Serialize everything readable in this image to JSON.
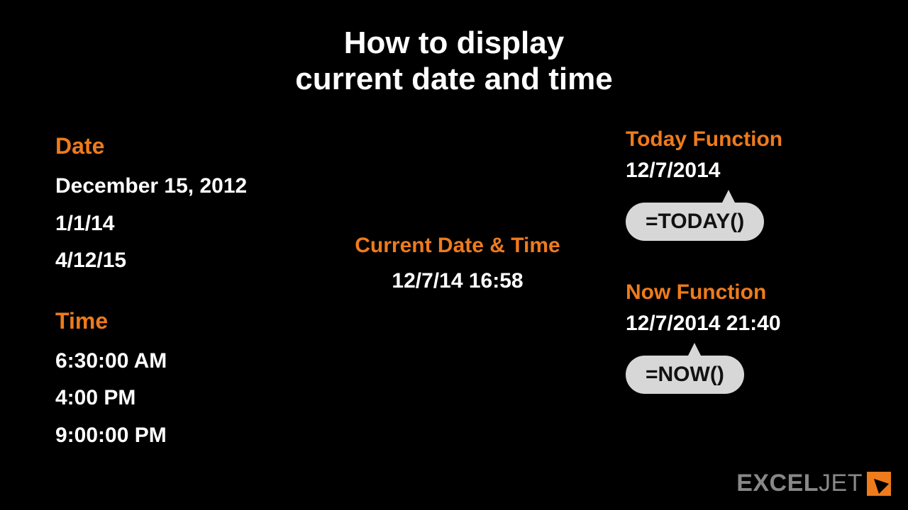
{
  "title_line1": "How to display",
  "title_line2": "current date and time",
  "left": {
    "date_heading": "Date",
    "dates": [
      "December 15, 2012",
      "1/1/14",
      "4/12/15"
    ],
    "time_heading": "Time",
    "times": [
      "6:30:00 AM",
      "4:00 PM",
      "9:00:00 PM"
    ]
  },
  "middle": {
    "heading": "Current Date & Time",
    "value": "12/7/14 16:58"
  },
  "right": {
    "today": {
      "heading": "Today Function",
      "value": "12/7/2014",
      "formula": "=TODAY()"
    },
    "now": {
      "heading": "Now Function",
      "value": "12/7/2014 21:40",
      "formula": "=NOW()"
    }
  },
  "logo": {
    "bold": "EXCEL",
    "thin": "JET"
  }
}
